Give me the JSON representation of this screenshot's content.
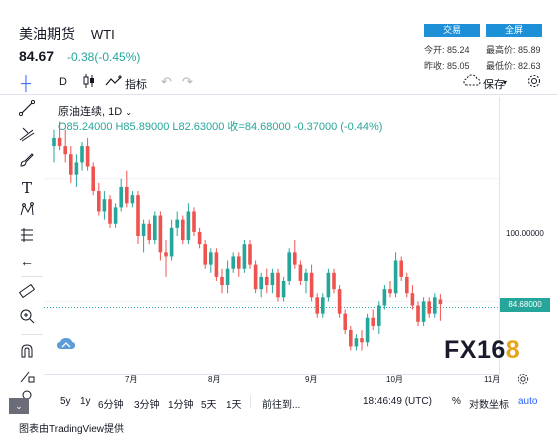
{
  "header": {
    "name": "美油期货",
    "symbol": "WTI",
    "price": "84.67",
    "change": "-0.38(-0.45%)",
    "btn_trade": "交易",
    "btn_fullscreen": "全屏",
    "stats": {
      "open_label": "今开:",
      "open": "85.24",
      "high_label": "最高价:",
      "high": "85.89",
      "prev_label": "昨收:",
      "prev": "85.05",
      "low_label": "最低价:",
      "low": "82.63"
    }
  },
  "toolbar": {
    "interval": "D",
    "indicators": "指标",
    "save": "保存"
  },
  "legend": {
    "series": "原油连续, 1D",
    "ohlc": "O85.24000  H85.89000  L82.63000  收=84.68000  -0.37000 (-0.44%)"
  },
  "axis": {
    "y_label": "100.00000",
    "last_price": "84.68000",
    "x_labels": [
      "7月",
      "8月",
      "9月",
      "10月",
      "11月"
    ]
  },
  "logo": {
    "main": "FX16",
    "accent": "8"
  },
  "bottom": {
    "ranges": [
      "5y",
      "1y",
      "6分钟",
      "3分钟",
      "1分钟",
      "5天",
      "1天"
    ],
    "goto": "前往到...",
    "time": "18:46:49 (UTC)",
    "percent": "%",
    "log": "对数坐标",
    "auto": "auto"
  },
  "footer": "图表由TradingView提供",
  "colors": {
    "up": "#26a69a",
    "down": "#ef5350",
    "accent": "#2962ff",
    "button": "#1e90d8"
  },
  "chart_data": {
    "type": "candlestick",
    "x_ticks": [
      "7月",
      "8月",
      "9月",
      "10月",
      "11月"
    ],
    "y_ticks": [
      100
    ],
    "last_value": 84.68,
    "series": [
      {
        "o": 104,
        "h": 106,
        "l": 102,
        "c": 105
      },
      {
        "o": 105,
        "h": 107,
        "l": 103.5,
        "c": 104
      },
      {
        "o": 104,
        "h": 106,
        "l": 102,
        "c": 103
      },
      {
        "o": 103,
        "h": 104,
        "l": 99.5,
        "c": 100.5
      },
      {
        "o": 100.5,
        "h": 103,
        "l": 99,
        "c": 102
      },
      {
        "o": 102,
        "h": 104.5,
        "l": 101,
        "c": 104
      },
      {
        "o": 104,
        "h": 105,
        "l": 101,
        "c": 101.5
      },
      {
        "o": 101.5,
        "h": 102,
        "l": 98,
        "c": 98.5
      },
      {
        "o": 98.5,
        "h": 99.5,
        "l": 95.5,
        "c": 96
      },
      {
        "o": 96,
        "h": 98.5,
        "l": 95,
        "c": 97.5
      },
      {
        "o": 97.5,
        "h": 98,
        "l": 94,
        "c": 94.5
      },
      {
        "o": 94.5,
        "h": 97,
        "l": 94,
        "c": 96.5
      },
      {
        "o": 96.5,
        "h": 100,
        "l": 96,
        "c": 99
      },
      {
        "o": 99,
        "h": 101,
        "l": 96.5,
        "c": 97
      },
      {
        "o": 97,
        "h": 98.5,
        "l": 96.5,
        "c": 98
      },
      {
        "o": 98,
        "h": 98.5,
        "l": 92,
        "c": 93
      },
      {
        "o": 93,
        "h": 95,
        "l": 91,
        "c": 94.5
      },
      {
        "o": 94.5,
        "h": 95,
        "l": 92,
        "c": 92.5
      },
      {
        "o": 92.5,
        "h": 96,
        "l": 92,
        "c": 95.5
      },
      {
        "o": 95.5,
        "h": 96,
        "l": 90,
        "c": 91
      },
      {
        "o": 91,
        "h": 92.5,
        "l": 88,
        "c": 90.5
      },
      {
        "o": 90.5,
        "h": 95,
        "l": 90,
        "c": 94
      },
      {
        "o": 94,
        "h": 96,
        "l": 93,
        "c": 95
      },
      {
        "o": 95,
        "h": 95.5,
        "l": 92,
        "c": 92.5
      },
      {
        "o": 92.5,
        "h": 97,
        "l": 92,
        "c": 96
      },
      {
        "o": 96,
        "h": 96.5,
        "l": 93,
        "c": 93.5
      },
      {
        "o": 93.5,
        "h": 94,
        "l": 91.5,
        "c": 92
      },
      {
        "o": 92,
        "h": 92.5,
        "l": 89,
        "c": 89.5
      },
      {
        "o": 89.5,
        "h": 91.5,
        "l": 88.5,
        "c": 91
      },
      {
        "o": 91,
        "h": 91.5,
        "l": 87.5,
        "c": 88
      },
      {
        "o": 88,
        "h": 89,
        "l": 86,
        "c": 87
      },
      {
        "o": 87,
        "h": 90,
        "l": 86,
        "c": 89
      },
      {
        "o": 89,
        "h": 91,
        "l": 88.5,
        "c": 90.5
      },
      {
        "o": 90.5,
        "h": 91,
        "l": 88,
        "c": 89
      },
      {
        "o": 89,
        "h": 92.5,
        "l": 88.5,
        "c": 92
      },
      {
        "o": 92,
        "h": 92.5,
        "l": 89,
        "c": 89.5
      },
      {
        "o": 89.5,
        "h": 90,
        "l": 86,
        "c": 86.5
      },
      {
        "o": 86.5,
        "h": 88.5,
        "l": 85.5,
        "c": 88
      },
      {
        "o": 88,
        "h": 89,
        "l": 86,
        "c": 87
      },
      {
        "o": 87,
        "h": 89,
        "l": 86,
        "c": 88.5
      },
      {
        "o": 88.5,
        "h": 89,
        "l": 85,
        "c": 85.5
      },
      {
        "o": 85.5,
        "h": 88,
        "l": 85,
        "c": 87.5
      },
      {
        "o": 87.5,
        "h": 91.5,
        "l": 87,
        "c": 91
      },
      {
        "o": 91,
        "h": 92.5,
        "l": 89,
        "c": 89.5
      },
      {
        "o": 89.5,
        "h": 90,
        "l": 87,
        "c": 87.5
      },
      {
        "o": 87.5,
        "h": 89,
        "l": 86,
        "c": 88.5
      },
      {
        "o": 88.5,
        "h": 89.5,
        "l": 85,
        "c": 85.5
      },
      {
        "o": 85.5,
        "h": 86,
        "l": 83,
        "c": 83.5
      },
      {
        "o": 83.5,
        "h": 86,
        "l": 83,
        "c": 85.5
      },
      {
        "o": 85.5,
        "h": 89,
        "l": 85,
        "c": 88.5
      },
      {
        "o": 88.5,
        "h": 89,
        "l": 86,
        "c": 86.5
      },
      {
        "o": 86.5,
        "h": 87,
        "l": 83,
        "c": 83.5
      },
      {
        "o": 83.5,
        "h": 84,
        "l": 81,
        "c": 81.5
      },
      {
        "o": 81.5,
        "h": 82,
        "l": 79,
        "c": 79.5
      },
      {
        "o": 79.5,
        "h": 81,
        "l": 79,
        "c": 80.5
      },
      {
        "o": 80.5,
        "h": 81.5,
        "l": 79,
        "c": 80
      },
      {
        "o": 80,
        "h": 83.5,
        "l": 79.5,
        "c": 83
      },
      {
        "o": 83,
        "h": 84,
        "l": 81.5,
        "c": 82
      },
      {
        "o": 82,
        "h": 85,
        "l": 81,
        "c": 84.5
      },
      {
        "o": 84.5,
        "h": 87,
        "l": 84,
        "c": 86.5
      },
      {
        "o": 86.5,
        "h": 87.5,
        "l": 85.5,
        "c": 86
      },
      {
        "o": 86,
        "h": 91,
        "l": 85.5,
        "c": 90
      },
      {
        "o": 90,
        "h": 90.5,
        "l": 87.5,
        "c": 88
      },
      {
        "o": 88,
        "h": 88.5,
        "l": 85.5,
        "c": 86
      },
      {
        "o": 86,
        "h": 87,
        "l": 84,
        "c": 84.5
      },
      {
        "o": 84.5,
        "h": 85,
        "l": 82,
        "c": 82.5
      },
      {
        "o": 82.5,
        "h": 85.5,
        "l": 82,
        "c": 85
      },
      {
        "o": 85,
        "h": 85.5,
        "l": 83,
        "c": 83.5
      },
      {
        "o": 83.5,
        "h": 86,
        "l": 83,
        "c": 85.5
      },
      {
        "o": 85.24,
        "h": 85.89,
        "l": 82.63,
        "c": 84.68
      }
    ],
    "ylim": [
      76,
      110
    ]
  }
}
